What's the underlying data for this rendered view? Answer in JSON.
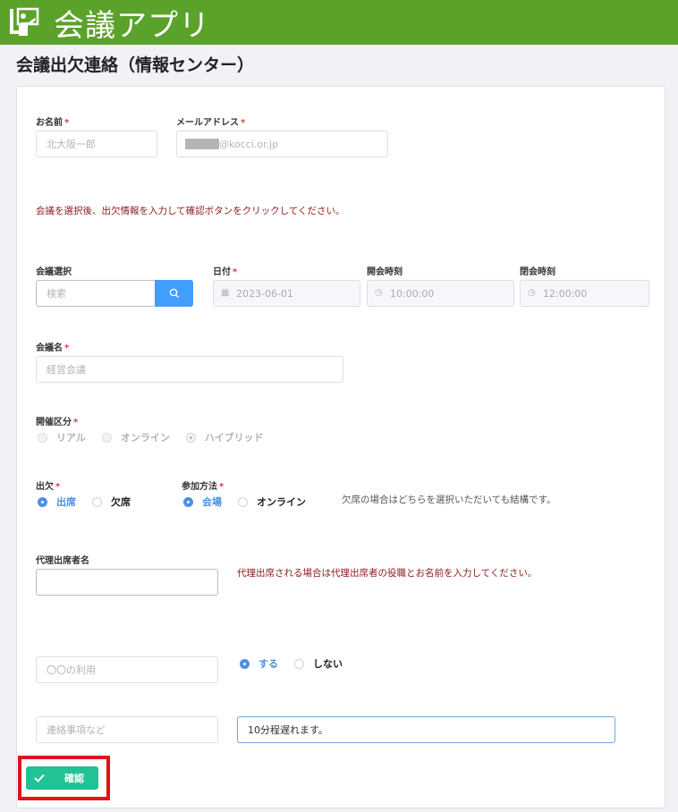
{
  "app": {
    "title": "会議アプリ",
    "logo_icon": "presenter-icon"
  },
  "page": {
    "title": "会議出欠連絡（情報センター）"
  },
  "required_mark": "*",
  "name": {
    "label": "お名前",
    "value": "北大阪一郎"
  },
  "email": {
    "label": "メールアドレス",
    "value_suffix": "@kocci.or.jp"
  },
  "instruction": "会議を選択後、出欠情報を入力して確認ボタンをクリックしてください。",
  "meeting_select": {
    "label": "会議選択",
    "placeholder": "検索"
  },
  "date": {
    "label": "日付",
    "value": "2023-06-01"
  },
  "start_time": {
    "label": "開会時刻",
    "value": "10:00:00"
  },
  "end_time": {
    "label": "閉会時刻",
    "value": "12:00:00"
  },
  "meeting_name": {
    "label": "会議名",
    "value": "経営会議"
  },
  "format": {
    "label": "開催区分",
    "options": [
      "リアル",
      "オンライン",
      "ハイブリッド"
    ],
    "selected": "ハイブリッド"
  },
  "attendance": {
    "label": "出欠",
    "options": [
      "出席",
      "欠席"
    ],
    "selected": "出席"
  },
  "method": {
    "label": "参加方法",
    "options": [
      "会場",
      "オンライン"
    ],
    "selected": "会場"
  },
  "absence_note": "欠席の場合はどちらを選択いただいても結構です。",
  "proxy": {
    "label": "代理出席者名",
    "value": "",
    "note": "代理出席される場合は代理出席者の役職とお名前を入力してください。"
  },
  "usage": {
    "placeholder": "〇〇の利用",
    "options": [
      "する",
      "しない"
    ],
    "selected": "する"
  },
  "contact": {
    "placeholder": "連絡事項など",
    "value": "10分程遅れます。"
  },
  "confirm": {
    "label": "確認"
  },
  "colors": {
    "header": "#5ba22b",
    "accent": "#409eff",
    "confirm": "#21c296",
    "highlight": "#e0131a"
  }
}
